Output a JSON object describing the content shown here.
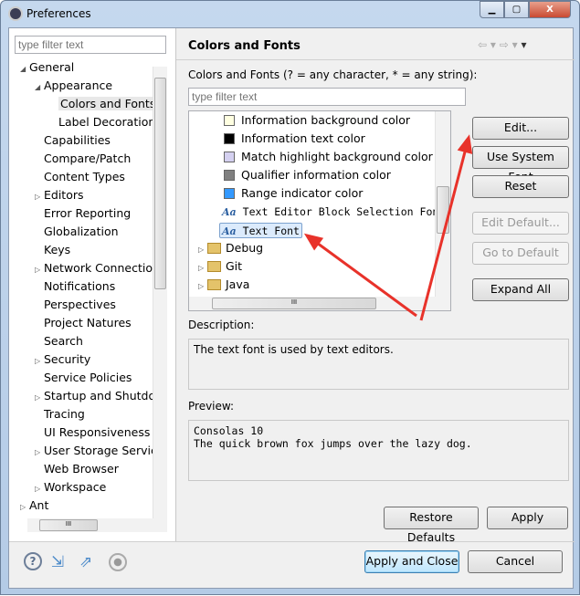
{
  "window": {
    "title": "Preferences"
  },
  "left": {
    "filter_placeholder": "type filter text",
    "tree": [
      {
        "label": "General",
        "level": 0,
        "state": "expanded"
      },
      {
        "label": "Appearance",
        "level": 1,
        "state": "expanded"
      },
      {
        "label": "Colors and Fonts",
        "level": 2,
        "state": "leaf",
        "selected": true
      },
      {
        "label": "Label Decorations",
        "level": 2,
        "state": "leaf"
      },
      {
        "label": "Capabilities",
        "level": 1,
        "state": "leaf"
      },
      {
        "label": "Compare/Patch",
        "level": 1,
        "state": "leaf"
      },
      {
        "label": "Content Types",
        "level": 1,
        "state": "leaf"
      },
      {
        "label": "Editors",
        "level": 1,
        "state": "collapsed"
      },
      {
        "label": "Error Reporting",
        "level": 1,
        "state": "leaf"
      },
      {
        "label": "Globalization",
        "level": 1,
        "state": "leaf"
      },
      {
        "label": "Keys",
        "level": 1,
        "state": "leaf"
      },
      {
        "label": "Network Connections",
        "level": 1,
        "state": "collapsed"
      },
      {
        "label": "Notifications",
        "level": 1,
        "state": "leaf"
      },
      {
        "label": "Perspectives",
        "level": 1,
        "state": "leaf"
      },
      {
        "label": "Project Natures",
        "level": 1,
        "state": "leaf"
      },
      {
        "label": "Search",
        "level": 1,
        "state": "leaf"
      },
      {
        "label": "Security",
        "level": 1,
        "state": "collapsed"
      },
      {
        "label": "Service Policies",
        "level": 1,
        "state": "leaf"
      },
      {
        "label": "Startup and Shutdown",
        "level": 1,
        "state": "collapsed"
      },
      {
        "label": "Tracing",
        "level": 1,
        "state": "leaf"
      },
      {
        "label": "UI Responsiveness",
        "level": 1,
        "state": "leaf"
      },
      {
        "label": "User Storage Service",
        "level": 1,
        "state": "collapsed"
      },
      {
        "label": "Web Browser",
        "level": 1,
        "state": "leaf"
      },
      {
        "label": "Workspace",
        "level": 1,
        "state": "collapsed"
      },
      {
        "label": "Ant",
        "level": 0,
        "state": "collapsed"
      }
    ]
  },
  "page": {
    "title": "Colors and Fonts",
    "filter_label": "Colors and Fonts (? = any character, * = any string):",
    "filter_placeholder": "type filter text",
    "items": [
      {
        "label": "Information background color",
        "kind": "color",
        "color": "#ffffe1"
      },
      {
        "label": "Information text color",
        "kind": "color",
        "color": "#000000"
      },
      {
        "label": "Match highlight background color",
        "kind": "color",
        "color": "#d4d0f0"
      },
      {
        "label": "Qualifier information color",
        "kind": "color",
        "color": "#808080"
      },
      {
        "label": "Range indicator color",
        "kind": "color",
        "color": "#3399ff"
      },
      {
        "label": "Text Editor Block Selection Font",
        "kind": "font"
      },
      {
        "label": "Text Font",
        "kind": "font",
        "selected": true
      },
      {
        "label": "Debug",
        "kind": "category"
      },
      {
        "label": "Git",
        "kind": "category"
      },
      {
        "label": "Java",
        "kind": "category"
      }
    ],
    "buttons": {
      "edit": "Edit...",
      "use_system_font": "Use System Font",
      "reset": "Reset",
      "edit_default": "Edit Default...",
      "go_to_default": "Go to Default",
      "expand_all": "Expand All"
    },
    "description_label": "Description:",
    "description": "The text font is used by text editors.",
    "preview_label": "Preview:",
    "preview_lines": [
      "Consolas 10",
      "The quick brown fox jumps over the lazy dog."
    ],
    "restore_defaults": "Restore Defaults",
    "apply": "Apply"
  },
  "footer": {
    "apply_close": "Apply and Close",
    "cancel": "Cancel",
    "icons": [
      "help-icon",
      "import-icon",
      "export-icon",
      "oomph-icon"
    ]
  },
  "annotation_color": "#e8322a"
}
